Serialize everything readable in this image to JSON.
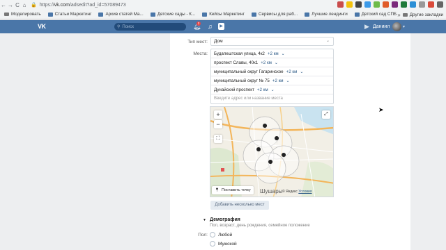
{
  "browser": {
    "url_scheme": "https://",
    "url_host": "vk.com",
    "url_path": "/adsedit?ad_id=57089473",
    "bookmarks": [
      {
        "label": "Моделировать",
        "type": "folder"
      },
      {
        "label": "Статьи Маркетинг",
        "type": "link"
      },
      {
        "label": "Архив статей Ма...",
        "type": "link"
      },
      {
        "label": "Детские сады - К...",
        "type": "link"
      },
      {
        "label": "Кейсы Маркетинг",
        "type": "link"
      },
      {
        "label": "Сервисы для раб...",
        "type": "link"
      },
      {
        "label": "Лучшие лендинги",
        "type": "link"
      },
      {
        "label": "Детский сад СПБ",
        "type": "link"
      }
    ],
    "other_bookmarks": "Другие закладки"
  },
  "vk_header": {
    "logo": "VK",
    "search_placeholder": "Поиск",
    "notification_count": "2",
    "user_name": "Даниил"
  },
  "form": {
    "place_type_label": "Тип мест:",
    "place_type_value": "Дом",
    "places_label": "Места:",
    "places": [
      {
        "name": "Будапештская улица, 4к2",
        "radius": "+2 км"
      },
      {
        "name": "проспект Славы, 40к1",
        "radius": "+2 км"
      },
      {
        "name": "муниципальный округ Гагаринское",
        "radius": "+2 км"
      },
      {
        "name": "муниципальный округ № 75",
        "radius": "+2 км"
      },
      {
        "name": "Дунайский проспект",
        "radius": "+2 км"
      }
    ],
    "places_input_placeholder": "Введите адрес или название места",
    "set_point_label": "Поставить точку",
    "map_city_label": "Шушары",
    "map_copyright": "© Яндекс",
    "map_terms": "Условия",
    "add_places_button": "Добавить несколько мест",
    "demography_title": "Демография",
    "demography_subtitle": "Пол, возраст, день рождения, семейное положение",
    "gender_label": "Пол:",
    "gender_options": [
      "Любой",
      "Мужской"
    ]
  },
  "colors": {
    "vk_blue": "#4a76a8",
    "link": "#2a5885"
  }
}
